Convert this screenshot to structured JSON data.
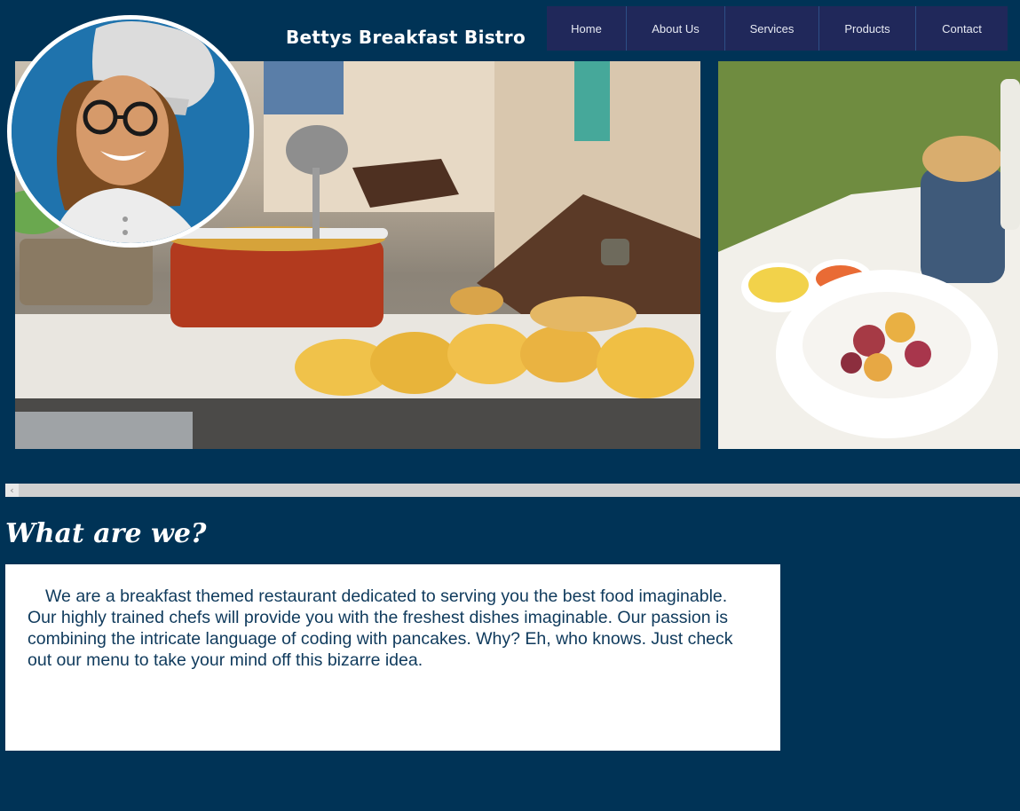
{
  "site": {
    "title": "Bettys Breakfast Bistro"
  },
  "nav": {
    "items": [
      {
        "label": "Home"
      },
      {
        "label": "About Us"
      },
      {
        "label": "Services"
      },
      {
        "label": "Products"
      },
      {
        "label": "Contact"
      }
    ]
  },
  "gallery": {
    "scroll_left_glyph": "‹"
  },
  "about": {
    "heading": "What are we?",
    "body": "We are a breakfast themed restaurant dedicated to serving you the best food imaginable. Our highly trained chefs will provide you with the freshest dishes imaginable. Our passion is combining the intricate language of coding with pancakes. Why? Eh, who knows. Just check out our menu to take your mind off this bizarre idea."
  },
  "colors": {
    "page_background": "#003356",
    "nav_background": "#20285a",
    "box_background": "#ffffff",
    "body_text": "#0f3a5c",
    "avatar_background": "#1f73ad"
  }
}
